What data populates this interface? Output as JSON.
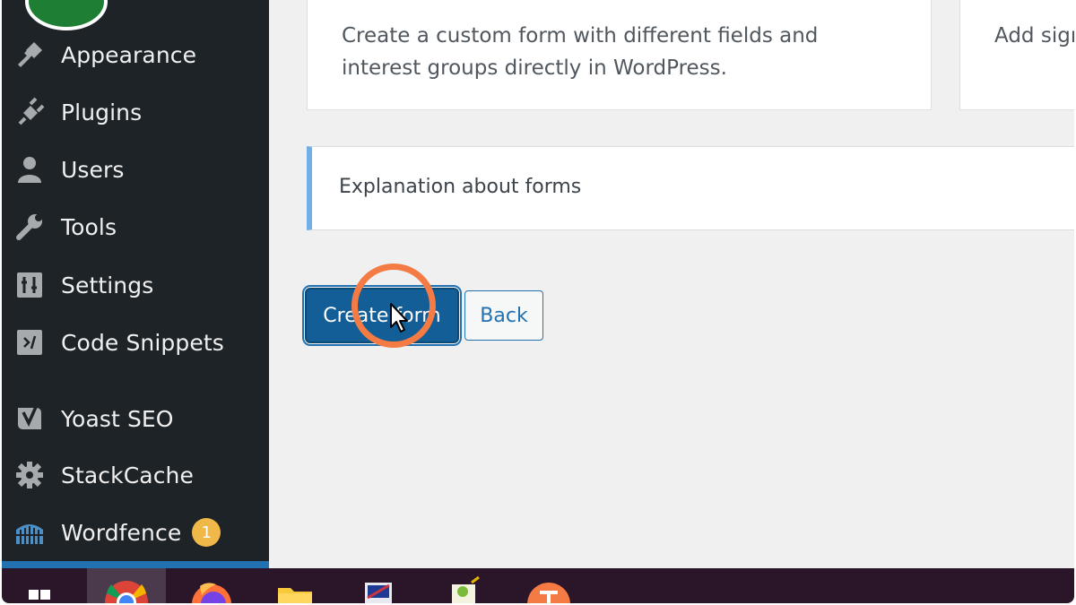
{
  "sidebar": {
    "items": [
      {
        "label": "Appearance",
        "icon": "paintbrush-icon"
      },
      {
        "label": "Plugins",
        "icon": "plug-icon"
      },
      {
        "label": "Users",
        "icon": "user-icon"
      },
      {
        "label": "Tools",
        "icon": "wrench-icon"
      },
      {
        "label": "Settings",
        "icon": "sliders-icon"
      },
      {
        "label": "Code Snippets",
        "icon": "code-icon"
      },
      {
        "label": "Yoast SEO",
        "icon": "yoast-icon"
      },
      {
        "label": "StackCache",
        "icon": "gear-icon"
      },
      {
        "label": "Wordfence",
        "icon": "wordfence-icon",
        "badge": "1"
      }
    ]
  },
  "main": {
    "card_custom_form": "Create a custom form with different fields and interest groups directly in WordPress.",
    "card_signup_partial": "Add sign",
    "notice": "Explanation about forms",
    "create_button": "Create form",
    "back_button": "Back"
  },
  "taskbar": {
    "apps": [
      "windows-start-icon",
      "chrome-icon",
      "firefox-icon",
      "file-explorer-icon",
      "app-icon",
      "notepad-icon",
      "app-orange-icon"
    ]
  },
  "colors": {
    "sidebar_bg": "#1d2327",
    "primary": "#2271b1",
    "badge": "#f0b849",
    "highlight_ring": "#f47b43",
    "taskbar_bg": "#2a1628"
  }
}
